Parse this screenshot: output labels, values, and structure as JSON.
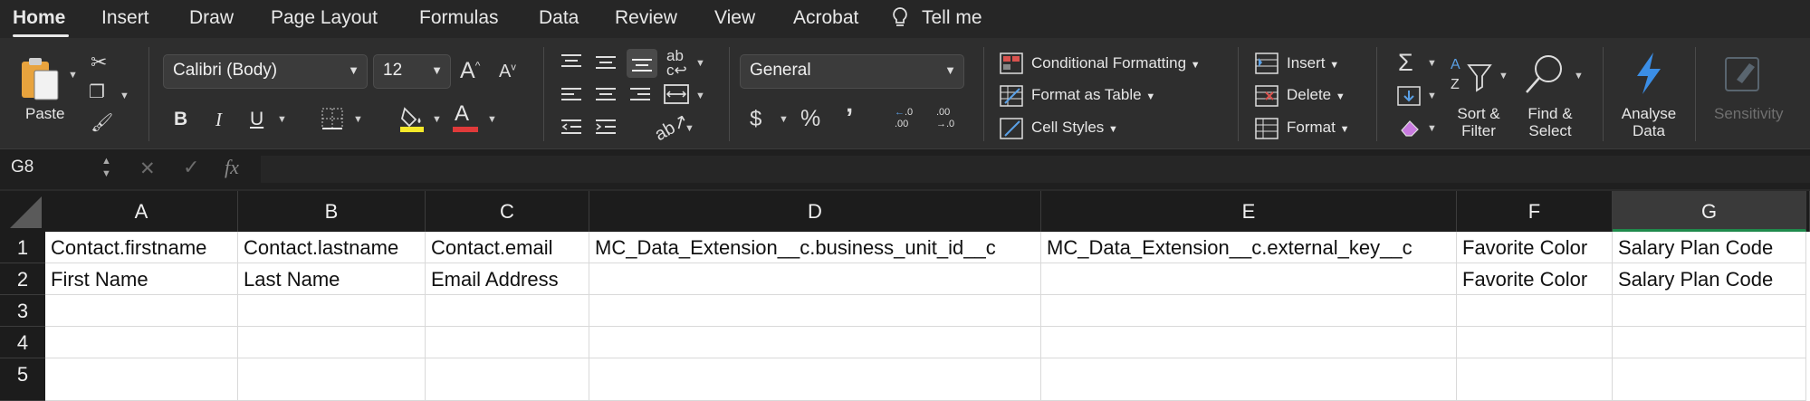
{
  "menu": {
    "tabs": [
      "Home",
      "Insert",
      "Draw",
      "Page Layout",
      "Formulas",
      "Data",
      "Review",
      "View",
      "Acrobat"
    ],
    "tell_me": "Tell me"
  },
  "ribbon": {
    "paste_label": "Paste",
    "font_name": "Calibri (Body)",
    "font_size": "12",
    "bold": "B",
    "italic": "I",
    "underline": "U",
    "font_color_glyph": "A",
    "increase_font": "A",
    "decrease_font": "A",
    "number_format": "General",
    "currency": "$",
    "percent": "%",
    "comma": "ʼ",
    "increase_decimal_top": ".0",
    "increase_decimal_bottom": ".00",
    "decrease_decimal_top": ".00",
    "decrease_decimal_bottom": "→.0",
    "conditional_formatting": "Conditional Formatting",
    "format_as_table": "Format as Table",
    "cell_styles": "Cell Styles",
    "insert": "Insert",
    "delete": "Delete",
    "format": "Format",
    "sort_filter_line1": "Sort &",
    "sort_filter_line2": "Filter",
    "find_select_line1": "Find &",
    "find_select_line2": "Select",
    "analyse_line1": "Analyse",
    "analyse_line2": "Data",
    "sensitivity": "Sensitivity",
    "colors": {
      "highlight": "#f5e829",
      "font_red": "#e03a3a",
      "analyse_blue": "#3b8ee6"
    }
  },
  "formula_bar": {
    "name_box": "G8",
    "fx": "fx",
    "cancel": "✕",
    "enter": "✓",
    "content": ""
  },
  "sheet": {
    "columns": [
      "A",
      "B",
      "C",
      "D",
      "E",
      "F",
      "G"
    ],
    "selected_column": "G",
    "row_numbers": [
      "1",
      "2",
      "3",
      "4",
      "5"
    ],
    "rows": [
      [
        "Contact.firstname",
        "Contact.lastname",
        "Contact.email",
        "MC_Data_Extension__c.business_unit_id__c",
        "MC_Data_Extension__c.external_key__c",
        "Favorite Color",
        "Salary Plan Code"
      ],
      [
        "First Name",
        "Last Name",
        "Email Address",
        "",
        "",
        "Favorite Color",
        "Salary Plan Code"
      ],
      [
        "",
        "",
        "",
        "",
        "",
        "",
        ""
      ],
      [
        "",
        "",
        "",
        "",
        "",
        "",
        ""
      ],
      [
        "",
        "",
        "",
        "",
        "",
        "",
        ""
      ]
    ]
  }
}
